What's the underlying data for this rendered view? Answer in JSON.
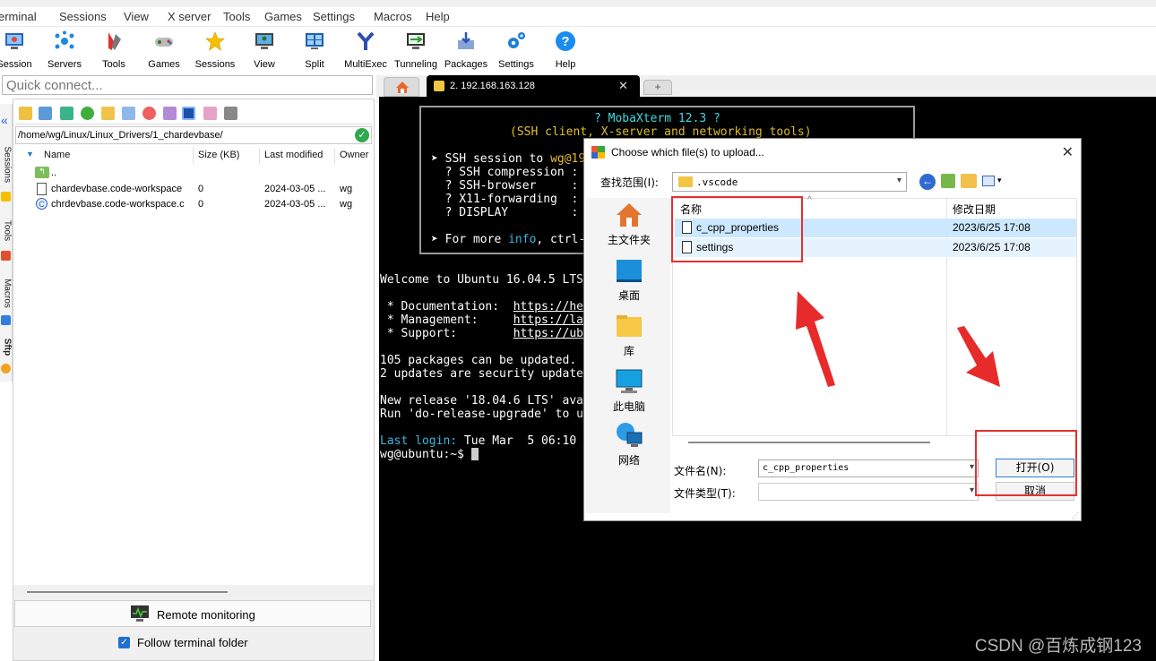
{
  "menu": [
    "erminal",
    "Sessions",
    "View",
    "X server",
    "Tools",
    "Games",
    "Settings",
    "Macros",
    "Help"
  ],
  "toolbar": [
    "Session",
    "Servers",
    "Tools",
    "Games",
    "Sessions",
    "View",
    "Split",
    "MultiExec",
    "Tunneling",
    "Packages",
    "Settings",
    "Help"
  ],
  "quick_connect": {
    "placeholder": "Quick connect..."
  },
  "side_tabs": [
    "Sessions",
    "Tools",
    "Macros",
    "Sftp"
  ],
  "sftp": {
    "path": "/home/wg/Linux/Linux_Drivers/1_chardevbase/",
    "columns": [
      "Name",
      "Size (KB)",
      "Last modified",
      "Owner"
    ],
    "rows": [
      {
        "name": "..",
        "size": "",
        "modified": "",
        "owner": ""
      },
      {
        "name": "chardevbase.code-workspace",
        "size": "0",
        "modified": "2024-03-05 ...",
        "owner": "wg"
      },
      {
        "name": "chrdevbase.code-workspace.c",
        "size": "0",
        "modified": "2024-03-05 ...",
        "owner": "wg"
      }
    ],
    "remote_monitoring": "Remote monitoring",
    "follow_terminal": "Follow terminal folder"
  },
  "terminal_tab": {
    "title": "2. 192.168.163.128"
  },
  "terminal": {
    "banner_title": "? MobaXterm 12.3 ?",
    "banner_sub": "(SSH client, X-server and networking tools)",
    "ssh_session": "➤ SSH session to ",
    "ssh_user": "wg@19",
    "ssh_compression": "  ? SSH compression : ",
    "ssh_browser": "  ? SSH-browser     : ",
    "x11": "  ? X11-forwarding  : ",
    "display": "  ? DISPLAY         : ",
    "more_info_a": "➤ For more ",
    "more_info_b": "info",
    "more_info_c": ", ctrl-",
    "welcome": "Welcome to Ubuntu 16.04.5 LTS",
    "doc": " * Documentation:  ",
    "doc_url": "https://he",
    "mgmt": " * Management:     ",
    "mgmt_url": "https://la",
    "support": " * Support:        ",
    "support_url": "https://ub",
    "packages": "105 packages can be updated.",
    "security": "2 updates are security update",
    "release": "New release '18.04.6 LTS' ava",
    "upgrade": "Run 'do-release-upgrade' to u",
    "last_login_label": "Last login:",
    "last_login_value": " Tue Mar  5 06:10",
    "prompt": "wg@ubuntu:~$ "
  },
  "dialog": {
    "title": "Choose which file(s) to upload...",
    "lookin_label": "查找范围(I):",
    "lookin_value": ".vscode",
    "places": [
      "主文件夹",
      "桌面",
      "库",
      "此电脑",
      "网络"
    ],
    "col_name": "名称",
    "col_date": "修改日期",
    "files": [
      {
        "name": "c_cpp_properties",
        "date": "2023/6/25 17:08"
      },
      {
        "name": "settings",
        "date": "2023/6/25 17:08"
      }
    ],
    "filename_label": "文件名(N):",
    "filename_value": "c_cpp_properties",
    "filetype_label": "文件类型(T):",
    "open_button": "打开(O)",
    "cancel_button": "取消"
  },
  "watermark": "CSDN @百炼成钢123",
  "colors": {
    "terminal_bg": "#000000",
    "highlight_red": "#e53030",
    "selection": "#cce8ff"
  }
}
